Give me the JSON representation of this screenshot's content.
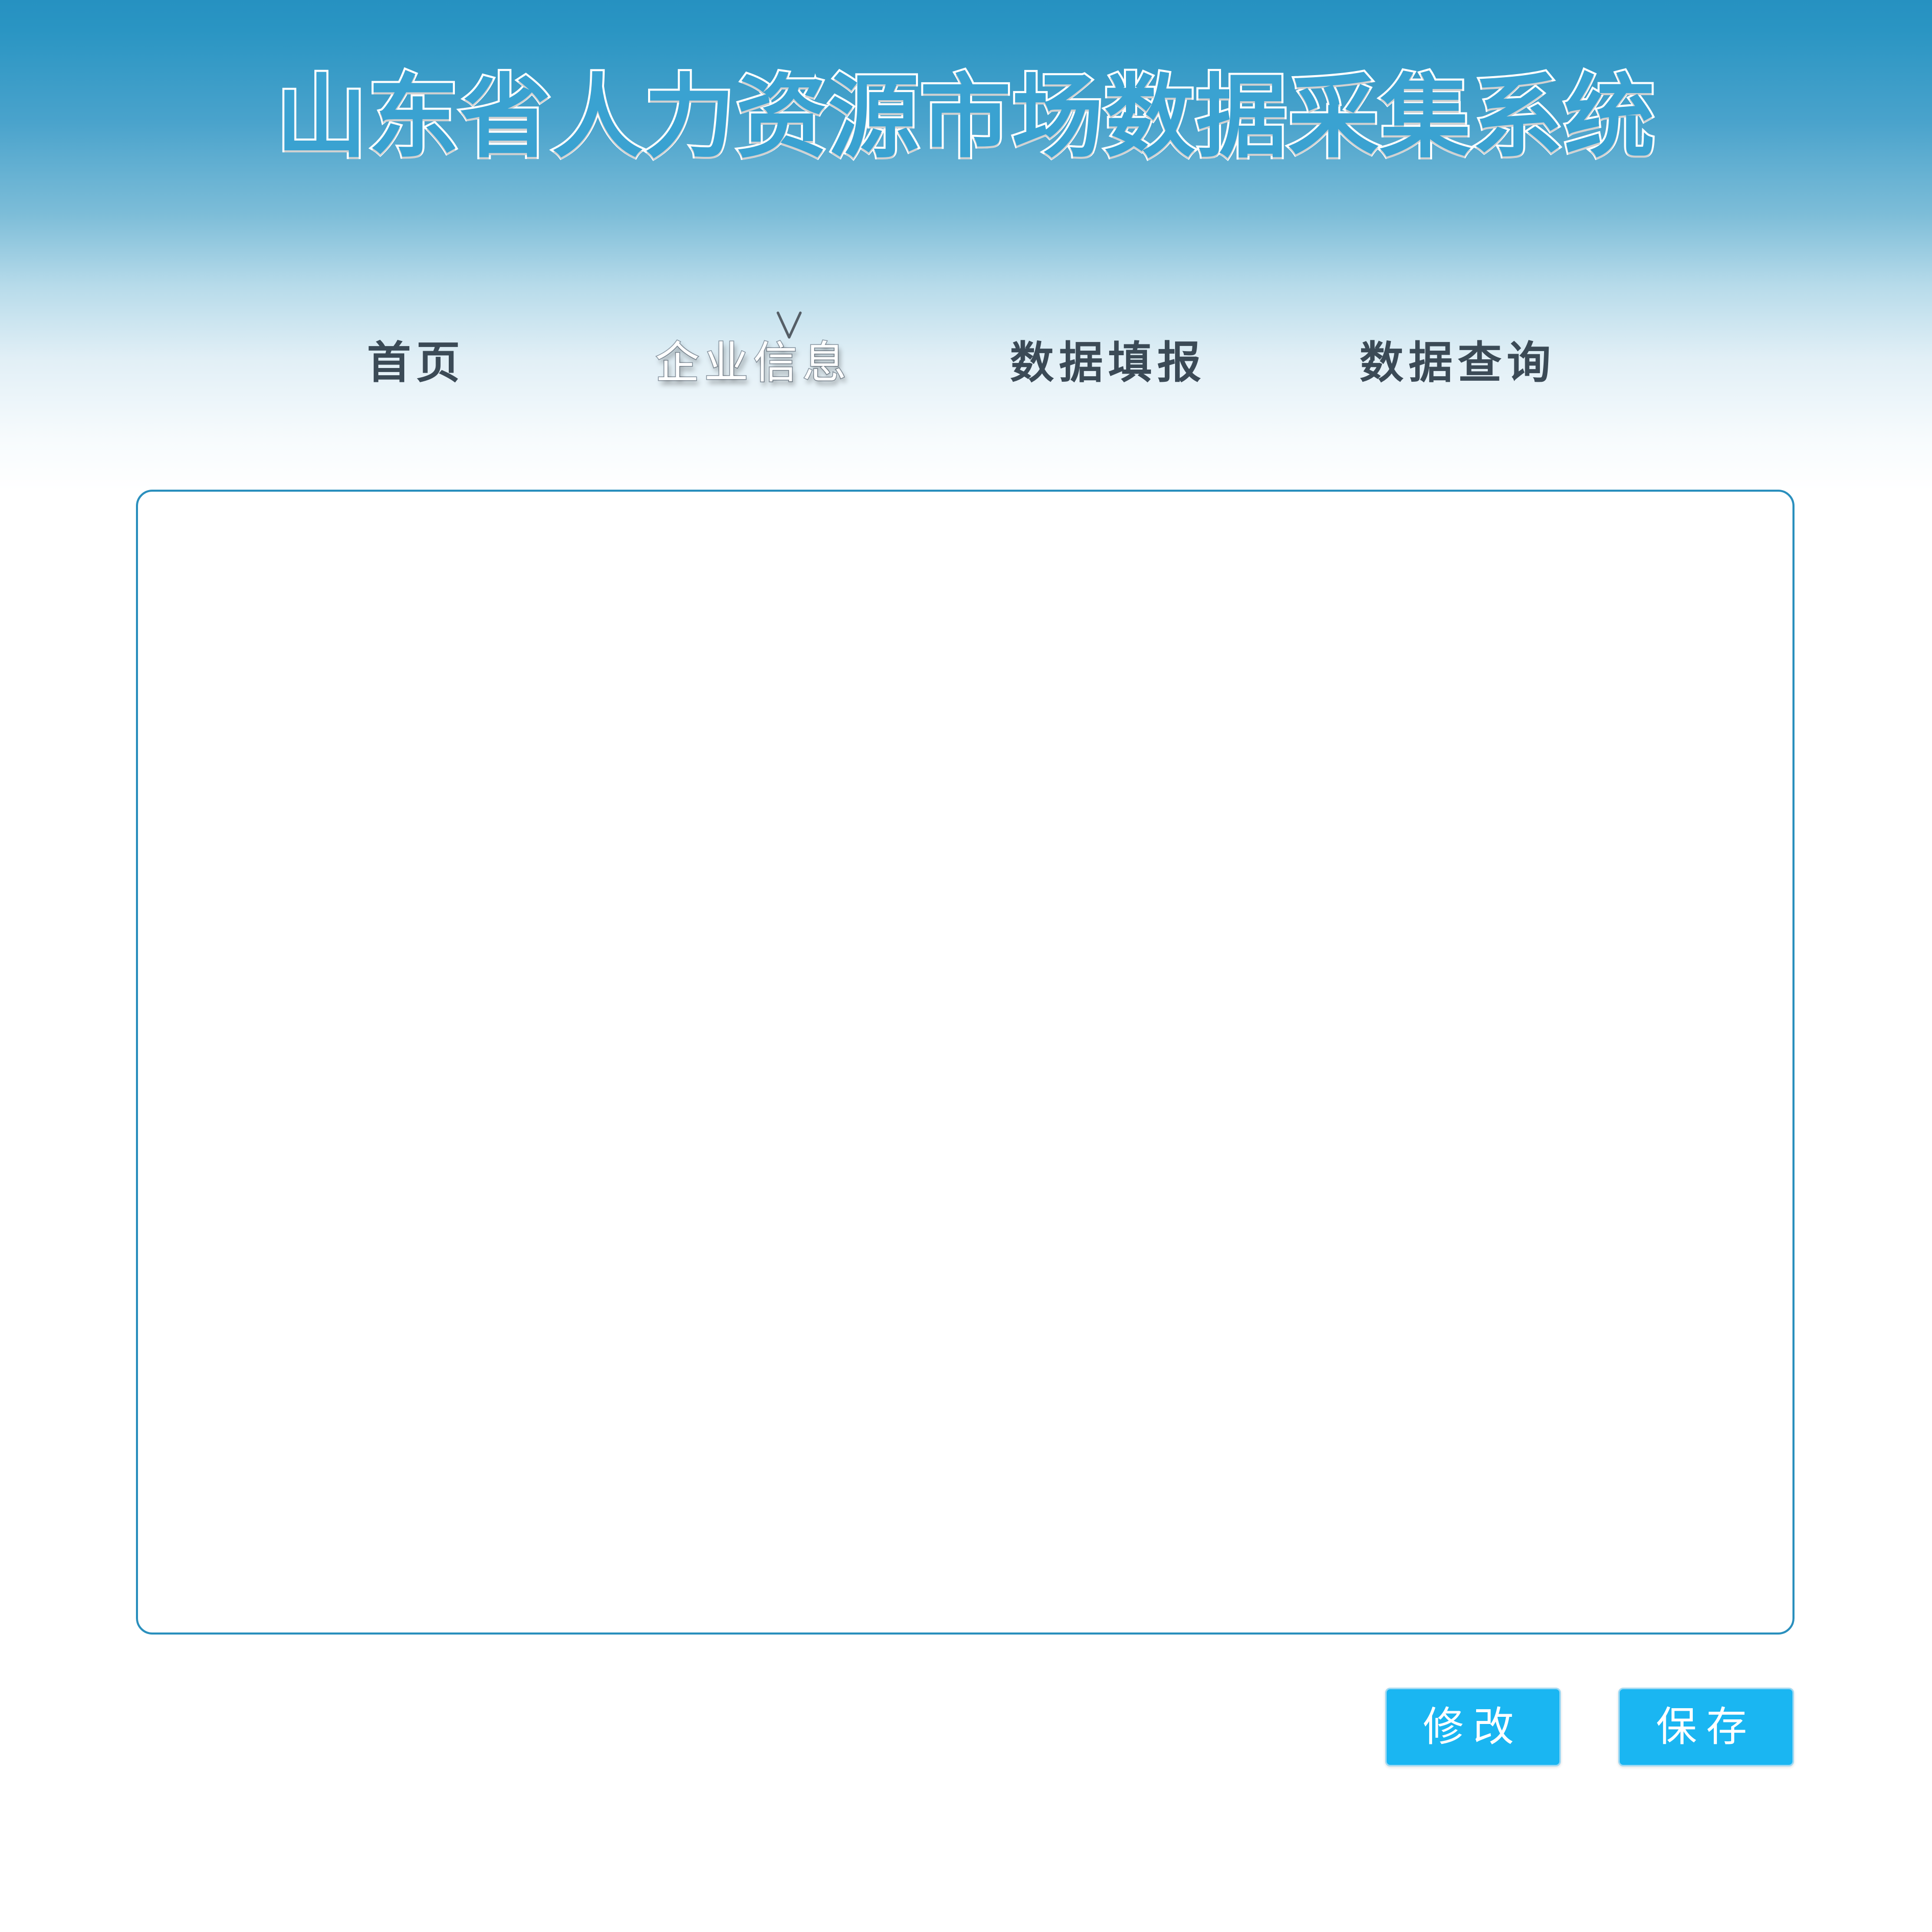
{
  "header": {
    "title": "山东省人力资源市场数据采集系统"
  },
  "nav": {
    "items": [
      {
        "label": "首页"
      },
      {
        "label": "企业信息"
      },
      {
        "label": "数据填报"
      },
      {
        "label": "数据查询"
      }
    ],
    "active": "企业信息"
  },
  "actions": {
    "modify_label": "修改",
    "save_label": "保存"
  },
  "colors": {
    "header_top": "#2691c1",
    "panel_border": "#2a8fbd",
    "button_bg": "#1ab6f2",
    "nav_text": "#3b4a56"
  }
}
